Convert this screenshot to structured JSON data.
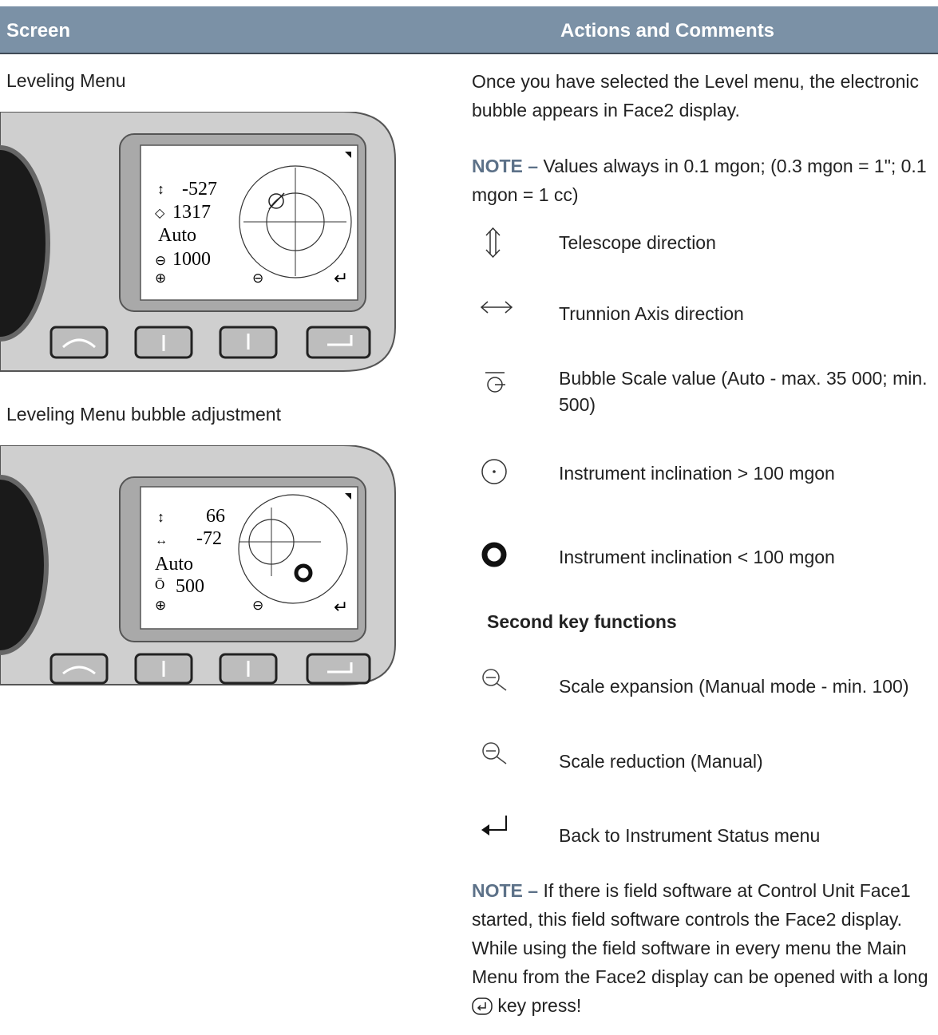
{
  "header": {
    "col_screen": "Screen",
    "col_actions": "Actions and Comments"
  },
  "left": {
    "caption1": "Leveling Menu",
    "screen1": {
      "vertical": "-527",
      "horizontal": "1317",
      "mode": "Auto",
      "scale": "1000"
    },
    "caption2": "Leveling Menu bubble adjustment",
    "screen2": {
      "vertical": "66",
      "horizontal": "-72",
      "mode": "Auto",
      "scale": "500"
    }
  },
  "right": {
    "intro": "Once you have selected the Level menu, the electronic bubble appears in Face2 display.",
    "note1_label": "NOTE –",
    "note1_text": " Values always in 0.1 mgon; (0.3 mgon = 1\"; 0.1 mgon = 1 cc)",
    "legend": [
      {
        "icon": "telescope-direction-icon",
        "text": "Telescope direction"
      },
      {
        "icon": "trunnion-axis-icon",
        "text": "Trunnion Axis direction"
      },
      {
        "icon": "bubble-scale-icon",
        "text": "Bubble Scale value (Auto - max. 35 000; min. 500)"
      },
      {
        "icon": "inclination-large-icon",
        "text": "Instrument inclination > 100 mgon"
      },
      {
        "icon": "inclination-small-icon",
        "text": "Instrument inclination < 100 mgon"
      }
    ],
    "second_key_heading": "Second key functions",
    "second_keys": [
      {
        "icon": "zoom-out-icon",
        "text": "Scale expansion (Manual mode - min. 100)"
      },
      {
        "icon": "zoom-out-icon",
        "text": "Scale reduction (Manual)"
      },
      {
        "icon": "enter-icon",
        "text": "Back to Instrument Status menu"
      }
    ],
    "note2_label": "NOTE –",
    "note2_text_a": " If there is field software at Control Unit Face1 started, this field software controls the Face2 display. While using the field software in every menu the Main Menu from the Face2 display can be opened with a long ",
    "note2_text_b": " key press!"
  },
  "colors": {
    "header_bg": "#7b91a6",
    "note_label": "#5c7188"
  }
}
